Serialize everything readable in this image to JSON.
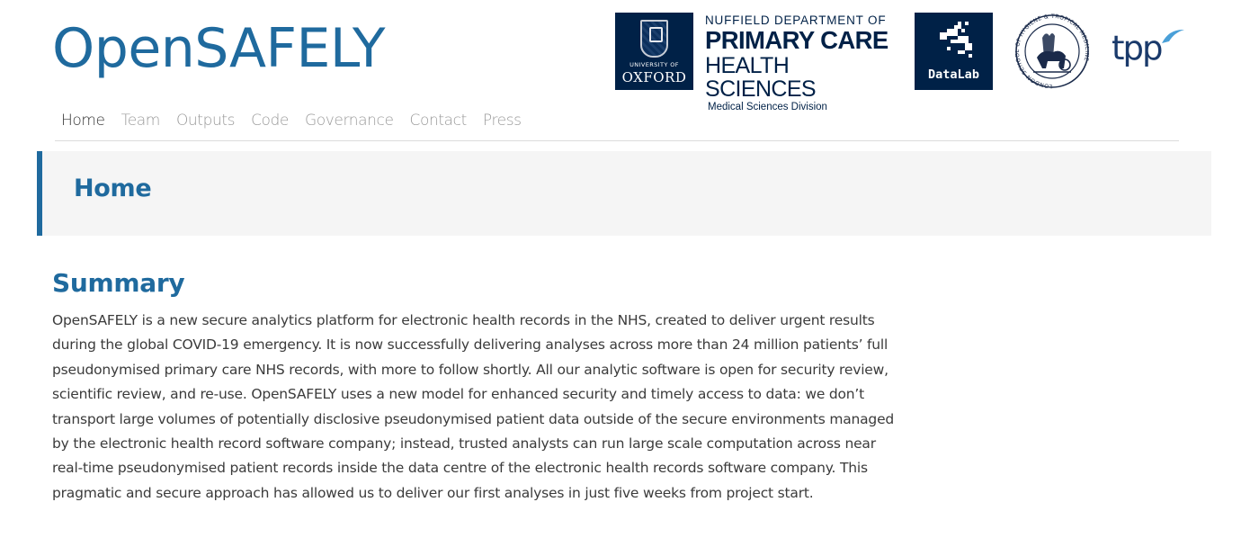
{
  "header": {
    "site_title": "OpenSAFELY",
    "logos": [
      {
        "id": "oxford",
        "name": "University of Oxford",
        "text_top": "UNIVERSITY OF",
        "text_bottom": "OXFORD",
        "color": "#002147"
      },
      {
        "id": "nuffield",
        "line1": "NUFFIELD DEPARTMENT OF",
        "line2": "PRIMARY CARE",
        "line3": "HEALTH SCIENCES",
        "line4": "Medical Sciences Division",
        "color": "#002147"
      },
      {
        "id": "datalab",
        "text": "DataLab",
        "color": "#002147"
      },
      {
        "id": "lshtm",
        "name": "London School of Hygiene & Tropical Medicine",
        "ring_text": "LONDON SCHOOL OF HYGIENE & TROPICAL MEDICINE"
      },
      {
        "id": "tpp",
        "text": "tpp",
        "color": "#1a3a6b"
      }
    ]
  },
  "nav": {
    "items": [
      {
        "label": "Home",
        "active": true
      },
      {
        "label": "Team",
        "active": false
      },
      {
        "label": "Outputs",
        "active": false
      },
      {
        "label": "Code",
        "active": false
      },
      {
        "label": "Governance",
        "active": false
      },
      {
        "label": "Contact",
        "active": false
      },
      {
        "label": "Press",
        "active": false
      }
    ]
  },
  "page": {
    "title": "Home"
  },
  "summary": {
    "heading": "Summary",
    "body": "OpenSAFELY is a new secure analytics platform for electronic health records in the NHS, created to deliver urgent results during the global COVID-19 emergency. It is now successfully delivering analyses across more than 24 million patients’ full pseudonymised primary care NHS records, with more to follow shortly. All our analytic software is open for security review, scientific review, and re-use. OpenSAFELY uses a new model for enhanced security and timely access to data: we don’t transport large volumes of potentially disclosive pseudonymised patient data outside of the secure environments managed by the electronic health record software company; instead, trusted analysts can run large scale computation across near real-time pseudonymised patient records inside the data centre of the electronic health records software company. This pragmatic and secure approach has allowed us to deliver our first analyses in just five weeks from project start."
  },
  "colors": {
    "brand_blue": "#1f6a9e",
    "navy": "#002147",
    "nav_inactive": "#9a9a9a",
    "band_bg": "#f5f5f5"
  }
}
